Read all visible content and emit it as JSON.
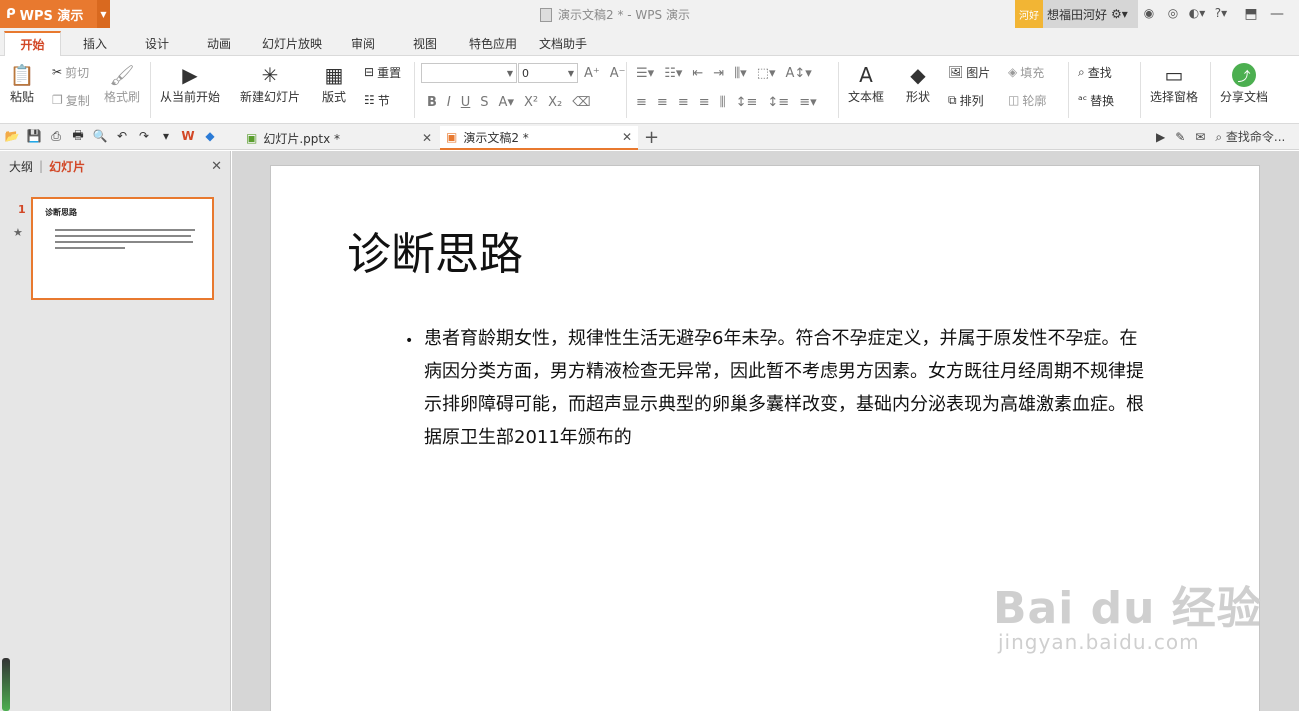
{
  "window": {
    "app_name": "WPS 演示",
    "doc_title": "演示文稿2 * - WPS 演示",
    "user_badge": "河好",
    "user_name": "想福田河好"
  },
  "menu_tabs": [
    {
      "label": "开始",
      "active": true
    },
    {
      "label": "插入"
    },
    {
      "label": "设计"
    },
    {
      "label": "动画"
    },
    {
      "label": "幻灯片放映"
    },
    {
      "label": "审阅"
    },
    {
      "label": "视图"
    },
    {
      "label": "特色应用"
    },
    {
      "label": "文档助手"
    }
  ],
  "ribbon": {
    "paste": "粘贴",
    "cut": "剪切",
    "copy": "复制",
    "format_painter": "格式刷",
    "from_current": "从当前开始",
    "new_slide": "新建幻灯片",
    "layout": "版式",
    "reset": "重置",
    "section": "节",
    "font_size": "0",
    "textbox": "文本框",
    "shape": "形状",
    "picture": "图片",
    "fill": "填充",
    "arrange": "排列",
    "outline": "轮廓",
    "find": "查找",
    "replace": "替换",
    "selection_pane": "选择窗格",
    "share_doc": "分享文档"
  },
  "doc_tabs": [
    {
      "label": "幻灯片.pptx *",
      "active": false
    },
    {
      "label": "演示文稿2 *",
      "active": true
    }
  ],
  "find_command": "查找命令...",
  "left_panel": {
    "tab_outline": "大纲",
    "tab_slides": "幻灯片",
    "slide_number": "1",
    "thumb_title": "诊断思路"
  },
  "slide": {
    "title": "诊断思路",
    "body": "患者育龄期女性，规律性生活无避孕6年未孕。符合不孕症定义，并属于原发性不孕症。在病因分类方面，男方精液检查无异常，因此暂不考虑男方因素。女方既往月经周期不规律提示排卵障碍可能，而超声显示典型的卵巢多囊样改变，基础内分泌表现为高雄激素血症。根据原卫生部2011年颁布的"
  },
  "watermark": {
    "logo": "Bai du 经验",
    "url": "jingyan.baidu.com"
  },
  "colors": {
    "accent": "#e8792f",
    "active_text": "#d24726"
  }
}
